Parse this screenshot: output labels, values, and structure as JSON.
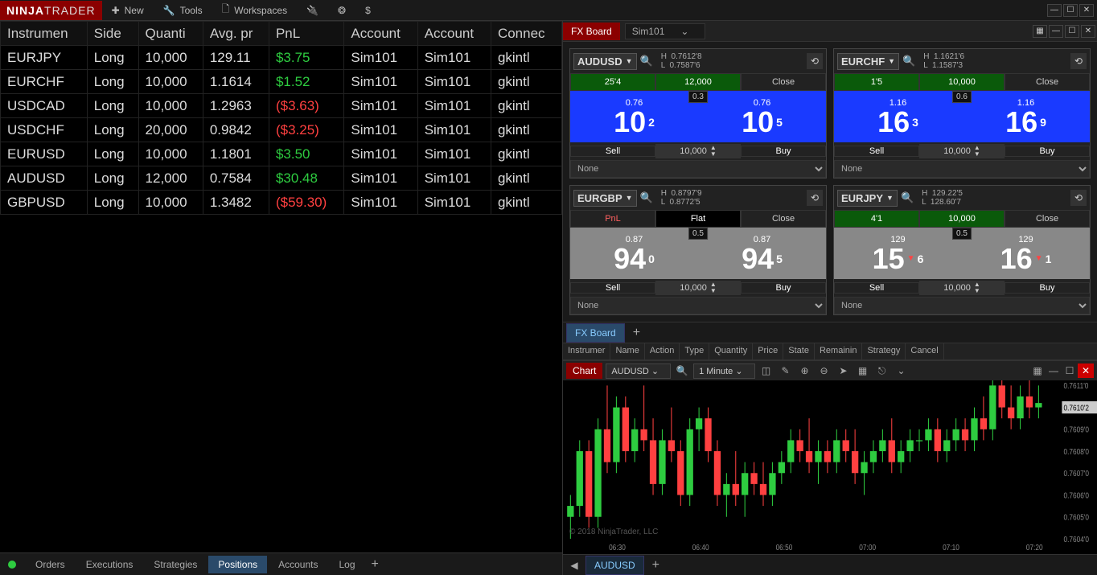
{
  "menu": {
    "new": "New",
    "tools": "Tools",
    "workspaces": "Workspaces"
  },
  "logo": {
    "a": "NINJA",
    "b": "TRADER"
  },
  "positions": {
    "headers": [
      "Instrumen",
      "Side",
      "Quanti",
      "Avg. pr",
      "PnL",
      "Account",
      "Account",
      "Connec"
    ],
    "rows": [
      {
        "inst": "EURJPY",
        "side": "Long",
        "qty": "10,000",
        "avg": "129.11",
        "pnl": "$3.75",
        "pos": true,
        "a1": "Sim101",
        "a2": "Sim101",
        "conn": "gkintl"
      },
      {
        "inst": "EURCHF",
        "side": "Long",
        "qty": "10,000",
        "avg": "1.1614",
        "pnl": "$1.52",
        "pos": true,
        "a1": "Sim101",
        "a2": "Sim101",
        "conn": "gkintl"
      },
      {
        "inst": "USDCAD",
        "side": "Long",
        "qty": "10,000",
        "avg": "1.2963",
        "pnl": "($3.63)",
        "pos": false,
        "a1": "Sim101",
        "a2": "Sim101",
        "conn": "gkintl"
      },
      {
        "inst": "USDCHF",
        "side": "Long",
        "qty": "20,000",
        "avg": "0.9842",
        "pnl": "($3.25)",
        "pos": false,
        "a1": "Sim101",
        "a2": "Sim101",
        "conn": "gkintl"
      },
      {
        "inst": "EURUSD",
        "side": "Long",
        "qty": "10,000",
        "avg": "1.1801",
        "pnl": "$3.50",
        "pos": true,
        "a1": "Sim101",
        "a2": "Sim101",
        "conn": "gkintl"
      },
      {
        "inst": "AUDUSD",
        "side": "Long",
        "qty": "12,000",
        "avg": "0.7584",
        "pnl": "$30.48",
        "pos": true,
        "a1": "Sim101",
        "a2": "Sim101",
        "conn": "gkintl"
      },
      {
        "inst": "GBPUSD",
        "side": "Long",
        "qty": "10,000",
        "avg": "1.3482",
        "pnl": "($59.30)",
        "pos": false,
        "a1": "Sim101",
        "a2": "Sim101",
        "conn": "gkintl"
      }
    ]
  },
  "btabs": {
    "orders": "Orders",
    "executions": "Executions",
    "strategies": "Strategies",
    "positions": "Positions",
    "accounts": "Accounts",
    "log": "Log"
  },
  "fx": {
    "title": "FX Board",
    "account": "Sim101",
    "close": "Close",
    "sell": "Sell",
    "buy": "Buy",
    "none": "None",
    "pnl": "PnL",
    "flat": "Flat",
    "tiles": [
      {
        "sym": "AUDUSD",
        "h": "0.7612'8",
        "l": "0.7587'6",
        "pips": "25'4",
        "qty": "12,000",
        "sp": "0.3",
        "bp": "0.76",
        "ap": "0.76",
        "big_b": "10",
        "sub_b": "2",
        "big_a": "10",
        "sub_a": "5",
        "oqty": "10,000",
        "bg": "blue",
        "status": "pos"
      },
      {
        "sym": "EURCHF",
        "h": "1.1621'6",
        "l": "1.1587'3",
        "pips": "1'5",
        "qty": "10,000",
        "sp": "0.6",
        "bp": "1.16",
        "ap": "1.16",
        "big_b": "16",
        "sub_b": "3",
        "big_a": "16",
        "sub_a": "9",
        "oqty": "10,000",
        "bg": "blue",
        "status": "pos"
      },
      {
        "sym": "EURGBP",
        "h": "0.8797'9",
        "l": "0.8772'5",
        "sp": "0.5",
        "bp": "0.87",
        "ap": "0.87",
        "big_b": "94",
        "sub_b": "0",
        "big_a": "94",
        "sub_a": "5",
        "oqty": "10,000",
        "bg": "gray",
        "status": "flat"
      },
      {
        "sym": "EURJPY",
        "h": "129.22'5",
        "l": "128.60'7",
        "pips": "4'1",
        "qty": "10,000",
        "sp": "0.5",
        "bp": "129",
        "ap": "129",
        "big_b": "15",
        "sub_b": "6",
        "big_a": "16",
        "sub_a": "1",
        "oqty": "10,000",
        "bg": "gray",
        "status": "pos",
        "arrow": "down"
      }
    ],
    "tab": "FX Board"
  },
  "orders_hdr": [
    "Instrumer",
    "Name",
    "Action",
    "Type",
    "Quantity",
    "Price",
    "State",
    "Remainin",
    "Strategy",
    "Cancel"
  ],
  "chart": {
    "title": "Chart",
    "sym": "AUDUSD",
    "tf": "1 Minute",
    "copyright": "© 2018 NinjaTrader, LLC",
    "ylabels": [
      "0.7611'0",
      "0.7610'2",
      "0.7609'0",
      "0.7608'0",
      "0.7607'0",
      "0.7606'0",
      "0.7605'0",
      "0.7604'0"
    ],
    "xlabels": [
      "06:30",
      "06:40",
      "06:50",
      "07:00",
      "07:10",
      "07:20"
    ],
    "tab": "AUDUSD"
  },
  "chart_data": {
    "type": "bar",
    "title": "AUDUSD 1 Minute",
    "ylim": [
      0.7604,
      0.7611
    ],
    "current": 0.76102,
    "x": [
      "06:30",
      "06:40",
      "06:50",
      "07:00",
      "07:10",
      "07:20"
    ],
    "candles": [
      {
        "o": 0.7605,
        "h": 0.7606,
        "l": 0.7604,
        "c": 0.76055,
        "up": true
      },
      {
        "o": 0.76055,
        "h": 0.76085,
        "l": 0.7605,
        "c": 0.7608,
        "up": true
      },
      {
        "o": 0.7608,
        "h": 0.76085,
        "l": 0.76045,
        "c": 0.7605,
        "up": false
      },
      {
        "o": 0.7605,
        "h": 0.76095,
        "l": 0.76045,
        "c": 0.7609,
        "up": true
      },
      {
        "o": 0.7609,
        "h": 0.7611,
        "l": 0.7607,
        "c": 0.76075,
        "up": false
      },
      {
        "o": 0.76075,
        "h": 0.76105,
        "l": 0.7607,
        "c": 0.761,
        "up": true
      },
      {
        "o": 0.761,
        "h": 0.76105,
        "l": 0.76075,
        "c": 0.7608,
        "up": false
      },
      {
        "o": 0.7608,
        "h": 0.76095,
        "l": 0.76075,
        "c": 0.7609,
        "up": true
      },
      {
        "o": 0.7609,
        "h": 0.7611,
        "l": 0.7608,
        "c": 0.76085,
        "up": false
      },
      {
        "o": 0.76085,
        "h": 0.76095,
        "l": 0.7606,
        "c": 0.76065,
        "up": false
      },
      {
        "o": 0.76065,
        "h": 0.7609,
        "l": 0.7606,
        "c": 0.76085,
        "up": true
      },
      {
        "o": 0.76085,
        "h": 0.761,
        "l": 0.76075,
        "c": 0.7608,
        "up": false
      },
      {
        "o": 0.7608,
        "h": 0.76085,
        "l": 0.76055,
        "c": 0.7606,
        "up": false
      },
      {
        "o": 0.7606,
        "h": 0.76095,
        "l": 0.76055,
        "c": 0.7609,
        "up": true
      },
      {
        "o": 0.7609,
        "h": 0.761,
        "l": 0.7608,
        "c": 0.76095,
        "up": true
      },
      {
        "o": 0.76095,
        "h": 0.761,
        "l": 0.76075,
        "c": 0.7608,
        "up": false
      },
      {
        "o": 0.7608,
        "h": 0.76085,
        "l": 0.76055,
        "c": 0.7606,
        "up": false
      },
      {
        "o": 0.7606,
        "h": 0.7607,
        "l": 0.7605,
        "c": 0.76065,
        "up": true
      },
      {
        "o": 0.76065,
        "h": 0.7608,
        "l": 0.76055,
        "c": 0.7606,
        "up": false
      },
      {
        "o": 0.7606,
        "h": 0.76075,
        "l": 0.7605,
        "c": 0.7607,
        "up": true
      },
      {
        "o": 0.7607,
        "h": 0.76075,
        "l": 0.7606,
        "c": 0.76065,
        "up": false
      },
      {
        "o": 0.76065,
        "h": 0.76075,
        "l": 0.76055,
        "c": 0.7606,
        "up": false
      },
      {
        "o": 0.7606,
        "h": 0.76075,
        "l": 0.76055,
        "c": 0.7607,
        "up": true
      },
      {
        "o": 0.7607,
        "h": 0.7608,
        "l": 0.76065,
        "c": 0.76075,
        "up": true
      },
      {
        "o": 0.76075,
        "h": 0.7609,
        "l": 0.7607,
        "c": 0.76085,
        "up": true
      },
      {
        "o": 0.76085,
        "h": 0.7609,
        "l": 0.76075,
        "c": 0.7608,
        "up": false
      },
      {
        "o": 0.7608,
        "h": 0.76095,
        "l": 0.7607,
        "c": 0.76075,
        "up": false
      },
      {
        "o": 0.76075,
        "h": 0.76085,
        "l": 0.76065,
        "c": 0.7608,
        "up": true
      },
      {
        "o": 0.7608,
        "h": 0.76085,
        "l": 0.7607,
        "c": 0.76075,
        "up": false
      },
      {
        "o": 0.76075,
        "h": 0.7609,
        "l": 0.7607,
        "c": 0.76085,
        "up": true
      },
      {
        "o": 0.76085,
        "h": 0.7609,
        "l": 0.76075,
        "c": 0.7608,
        "up": false
      },
      {
        "o": 0.7608,
        "h": 0.7609,
        "l": 0.76065,
        "c": 0.7607,
        "up": false
      },
      {
        "o": 0.7607,
        "h": 0.7608,
        "l": 0.7606,
        "c": 0.76075,
        "up": true
      },
      {
        "o": 0.76075,
        "h": 0.76085,
        "l": 0.7607,
        "c": 0.7608,
        "up": true
      },
      {
        "o": 0.7608,
        "h": 0.7609,
        "l": 0.76075,
        "c": 0.76085,
        "up": true
      },
      {
        "o": 0.76085,
        "h": 0.76095,
        "l": 0.7607,
        "c": 0.76075,
        "up": false
      },
      {
        "o": 0.76075,
        "h": 0.76085,
        "l": 0.7607,
        "c": 0.7608,
        "up": true
      },
      {
        "o": 0.7608,
        "h": 0.7609,
        "l": 0.76075,
        "c": 0.76085,
        "up": true
      },
      {
        "o": 0.76085,
        "h": 0.7609,
        "l": 0.7608,
        "c": 0.76085,
        "up": true
      },
      {
        "o": 0.76085,
        "h": 0.76095,
        "l": 0.7608,
        "c": 0.7609,
        "up": true
      },
      {
        "o": 0.7609,
        "h": 0.76095,
        "l": 0.76075,
        "c": 0.7608,
        "up": false
      },
      {
        "o": 0.7608,
        "h": 0.7609,
        "l": 0.76075,
        "c": 0.76085,
        "up": true
      },
      {
        "o": 0.76085,
        "h": 0.76095,
        "l": 0.7608,
        "c": 0.7609,
        "up": true
      },
      {
        "o": 0.7609,
        "h": 0.76095,
        "l": 0.7608,
        "c": 0.76085,
        "up": false
      },
      {
        "o": 0.76085,
        "h": 0.761,
        "l": 0.7608,
        "c": 0.76095,
        "up": true
      },
      {
        "o": 0.76095,
        "h": 0.76105,
        "l": 0.76085,
        "c": 0.7609,
        "up": false
      },
      {
        "o": 0.7609,
        "h": 0.76115,
        "l": 0.76085,
        "c": 0.7611,
        "up": true
      },
      {
        "o": 0.7611,
        "h": 0.76115,
        "l": 0.76095,
        "c": 0.761,
        "up": false
      },
      {
        "o": 0.761,
        "h": 0.7611,
        "l": 0.7609,
        "c": 0.76095,
        "up": false
      },
      {
        "o": 0.76095,
        "h": 0.7611,
        "l": 0.7609,
        "c": 0.76105,
        "up": true
      },
      {
        "o": 0.76105,
        "h": 0.76115,
        "l": 0.76095,
        "c": 0.761,
        "up": false
      },
      {
        "o": 0.761,
        "h": 0.7611,
        "l": 0.76095,
        "c": 0.76102,
        "up": true
      }
    ]
  }
}
